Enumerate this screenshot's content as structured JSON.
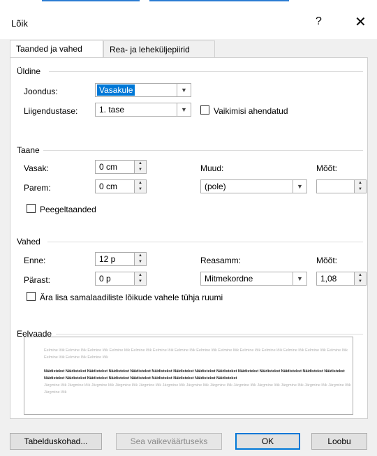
{
  "window": {
    "title": "Lõik",
    "help_label": "?",
    "close_label": "✕"
  },
  "tabs": [
    {
      "label": "Taanded ja vahed",
      "active": true
    },
    {
      "label": "Rea- ja leheküljepiirid",
      "active": false
    }
  ],
  "general": {
    "section_label": "Üldine",
    "alignment_label": "Joondus:",
    "alignment_value": "Vasakule",
    "outline_label": "Liigendustase:",
    "outline_value": "1. tase",
    "collapsed_label": "Vaikimisi ahendatud",
    "collapsed_checked": false
  },
  "indentation": {
    "section_label": "Taane",
    "left_label": "Vasak:",
    "left_value": "0 cm",
    "right_label": "Parem:",
    "right_value": "0 cm",
    "special_label": "Muud:",
    "special_value": "(pole)",
    "by_label": "Mõõt:",
    "by_value": "",
    "mirror_label": "Peegeltaanded",
    "mirror_checked": false
  },
  "spacing": {
    "section_label": "Vahed",
    "before_label": "Enne:",
    "before_value": "12 p",
    "after_label": "Pärast:",
    "after_value": "0 p",
    "line_label": "Reasamm:",
    "line_value": "Mitmekordne",
    "at_label": "Mõõt:",
    "at_value": "1,08",
    "dont_add_label": "Ära lisa samalaadiliste lõikude vahele tühja ruumi",
    "dont_add_checked": false
  },
  "preview": {
    "section_label": "Eelvaade",
    "previous_text": "Eelmine lõik Eelmine lõik Eelmine lõik Eelmine lõik Eelmine lõik Eelmine lõik Eelmine lõik Eelmine lõik Eelmine lõik Eelmine lõik Eelmine lõik Eelmine lõik Eelmine lõik Eelmine lõik Eelmine lõik Eelmine lõik Eelmine lõik",
    "sample_text": "Näidistekst Näidistekst Näidistekst Näidistekst Näidistekst Näidistekst Näidistekst Näidistekst Näidistekst Näidistekst Näidistekst Näidistekst Näidistekst Näidistekst Näidistekst Näidistekst Näidistekst Näidistekst Näidistekst Näidistekst Näidistekst Näidistekst Näidistekst",
    "next_text": "Järgmine lõik Järgmine lõik Järgmine lõik Järgmine lõik Järgmine lõik Järgmine lõik Järgmine lõik Järgmine lõik Järgmine lõik Järgmine lõik Järgmine lõik Järgmine lõik Järgmine lõik Järgmine lõik"
  },
  "buttons": {
    "tabs_label": "Tabelduskohad...",
    "default_label": "Sea vaikeväärtuseks",
    "ok_label": "OK",
    "cancel_label": "Loobu"
  },
  "colors": {
    "accent": "#0078d7",
    "background": "#f0f0f0",
    "panel": "#ffffff"
  }
}
